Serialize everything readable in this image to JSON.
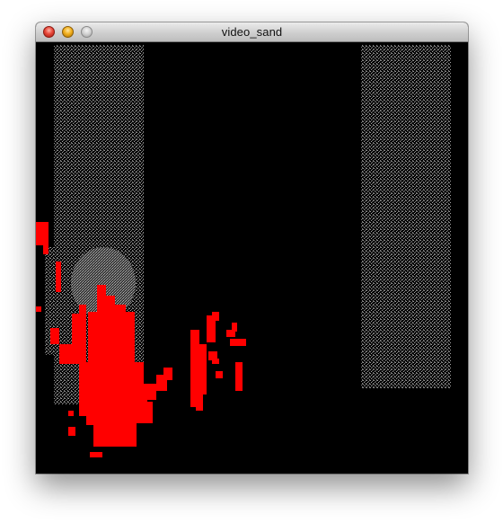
{
  "window": {
    "title": "video_sand"
  },
  "colors": {
    "sand": "#8c8c8c",
    "hand_mask": "#ff0000",
    "background": "#000000"
  },
  "icons": {
    "close": "close-icon",
    "minimize": "minimize-icon",
    "zoom": "zoom-icon"
  }
}
